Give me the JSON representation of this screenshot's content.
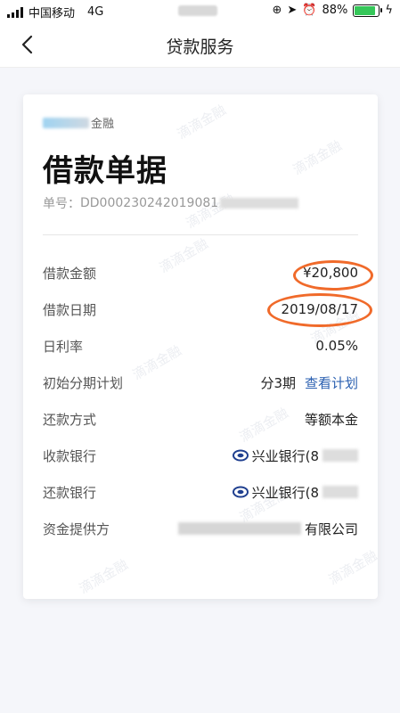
{
  "status_bar": {
    "carrier": "中国移动",
    "network": "4G",
    "battery": "88%"
  },
  "nav": {
    "title": "贷款服务"
  },
  "receipt": {
    "brand_suffix": "金融",
    "title": "借款单据",
    "order_label": "单号：",
    "order_number": "DD00023024201908​1",
    "watermark": "滴滴金融",
    "rows": [
      {
        "label": "借款金额",
        "value": "¥20,800"
      },
      {
        "label": "借款日期",
        "value": "2019/08/17"
      },
      {
        "label": "日利率",
        "value": "0.05%"
      },
      {
        "label": "初始分期计划",
        "value": "分3期",
        "link": "查看计划"
      },
      {
        "label": "还款方式",
        "value": "等额本金"
      },
      {
        "label": "收款银行",
        "value": "兴业银行(8"
      },
      {
        "label": "还款银行",
        "value": "兴业银行(8"
      },
      {
        "label": "资金提供方",
        "value": "有限公司"
      }
    ]
  },
  "highlight_color": "#f06a2a",
  "link_color": "#2a5fb0"
}
